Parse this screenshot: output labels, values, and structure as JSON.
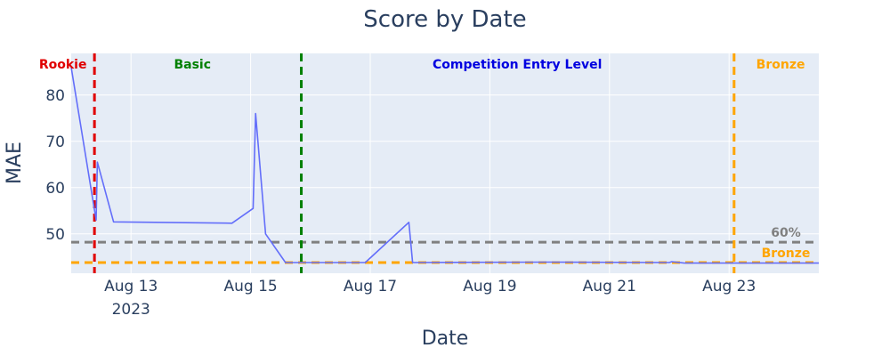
{
  "chart_data": {
    "type": "line",
    "title": "Score by Date",
    "xlabel": "Date",
    "ylabel": "MAE",
    "xlim": [
      "2023-08-12T00:00",
      "2023-08-24T12:00"
    ],
    "ylim": [
      41.5,
      89
    ],
    "x_ticks": [
      {
        "x": "2023-08-13",
        "label": "Aug 13",
        "sublabel": "2023"
      },
      {
        "x": "2023-08-15",
        "label": "Aug 15",
        "sublabel": ""
      },
      {
        "x": "2023-08-17",
        "label": "Aug 17",
        "sublabel": ""
      },
      {
        "x": "2023-08-19",
        "label": "Aug 19",
        "sublabel": ""
      },
      {
        "x": "2023-08-21",
        "label": "Aug 21",
        "sublabel": ""
      },
      {
        "x": "2023-08-23",
        "label": "Aug 23",
        "sublabel": ""
      }
    ],
    "y_ticks": [
      50,
      60,
      70,
      80
    ],
    "series": [
      {
        "color": "#636efa",
        "points": [
          [
            "2023-08-12T00:00",
            86.0
          ],
          [
            "2023-08-12T10:00",
            53.0
          ],
          [
            "2023-08-12T10:30",
            65.5
          ],
          [
            "2023-08-12T17:00",
            52.6
          ],
          [
            "2023-08-14T16:30",
            52.3
          ],
          [
            "2023-08-15T01:00",
            55.5
          ],
          [
            "2023-08-15T02:00",
            76.0
          ],
          [
            "2023-08-15T06:00",
            50.0
          ],
          [
            "2023-08-15T14:00",
            43.8
          ],
          [
            "2023-08-16T22:00",
            43.8
          ],
          [
            "2023-08-17T15:30",
            52.5
          ],
          [
            "2023-08-17T17:00",
            43.8
          ],
          [
            "2023-08-20T00:00",
            43.9
          ],
          [
            "2023-08-22T00:00",
            43.8
          ],
          [
            "2023-08-22T01:00",
            44.0
          ],
          [
            "2023-08-22T06:00",
            43.7
          ],
          [
            "2023-08-24T12:00",
            43.7
          ]
        ]
      }
    ],
    "vertical_lines": [
      {
        "x": "2023-08-12T09:20",
        "color": "#e00000"
      },
      {
        "x": "2023-08-15T20:20",
        "color": "#008000"
      },
      {
        "x": "2023-08-23T02:00",
        "color": "#ffa500"
      }
    ],
    "horizontal_lines": [
      {
        "y": 48.2,
        "color": "#808080",
        "label": "60%"
      },
      {
        "y": 43.8,
        "color": "#ffa500",
        "label": "Bronze"
      }
    ],
    "zones": [
      {
        "label": "Rookie",
        "color": "#e00000",
        "x": "2023-08-11T20:40"
      },
      {
        "label": "Basic",
        "color": "#008000",
        "x": "2023-08-14T00:40"
      },
      {
        "label": "Competition Entry Level",
        "color": "#0000e0",
        "x": "2023-08-19T11:00"
      },
      {
        "label": "Bronze",
        "color": "#ffa500",
        "x": "2023-08-23T20:40"
      }
    ]
  }
}
